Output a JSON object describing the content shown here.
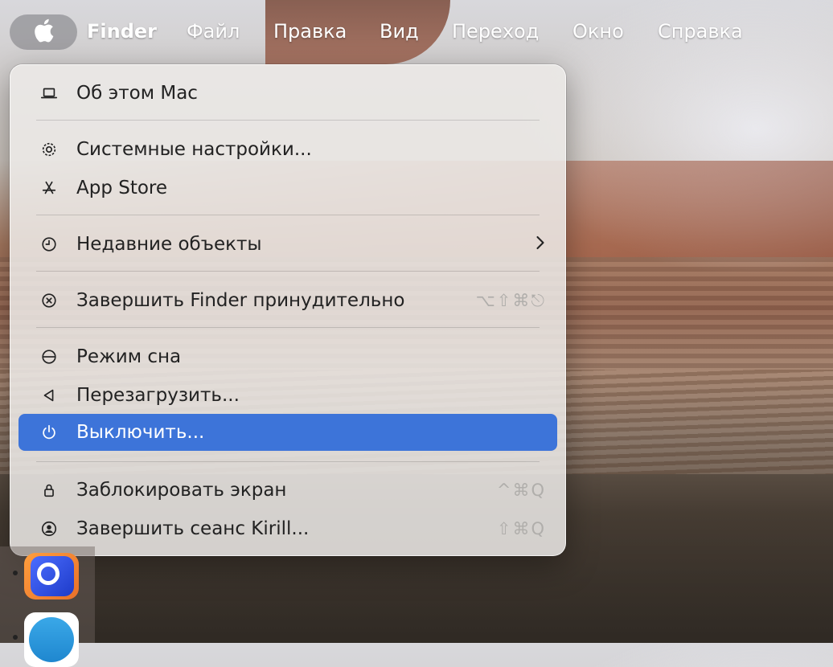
{
  "menubar": {
    "apple_icon": "apple-logo-icon",
    "items": [
      "Finder",
      "Файл",
      "Правка",
      "Вид",
      "Переход",
      "Окно",
      "Справка"
    ]
  },
  "apple_menu": {
    "items": [
      {
        "label": "Об этом Mac",
        "icon": "laptop-icon"
      },
      {
        "label": "Системные настройки...",
        "icon": "gear-icon"
      },
      {
        "label": "App Store",
        "icon": "appstore-icon"
      },
      {
        "label": "Недавние объекты",
        "icon": "clock-icon",
        "submenu_icon": "chevron-right-icon"
      },
      {
        "label": "Завершить Finder принудительно",
        "icon": "force-quit-icon",
        "shortcut": "⌥⇧⌘⎋"
      },
      {
        "label": "Режим сна",
        "icon": "sleep-icon"
      },
      {
        "label": "Перезагрузить...",
        "icon": "restart-icon"
      },
      {
        "label": "Выключить...",
        "icon": "power-icon",
        "highlighted": true
      },
      {
        "label": "Заблокировать экран",
        "icon": "lock-icon",
        "shortcut": "^⌘Q"
      },
      {
        "label": "Завершить сеанс Kirill...",
        "icon": "user-icon",
        "shortcut": "⇧⌘Q"
      }
    ]
  },
  "colors": {
    "highlight": "#3d74d9",
    "menu_bg": "#eceae8",
    "shortcut_text": "#b0aeab"
  }
}
